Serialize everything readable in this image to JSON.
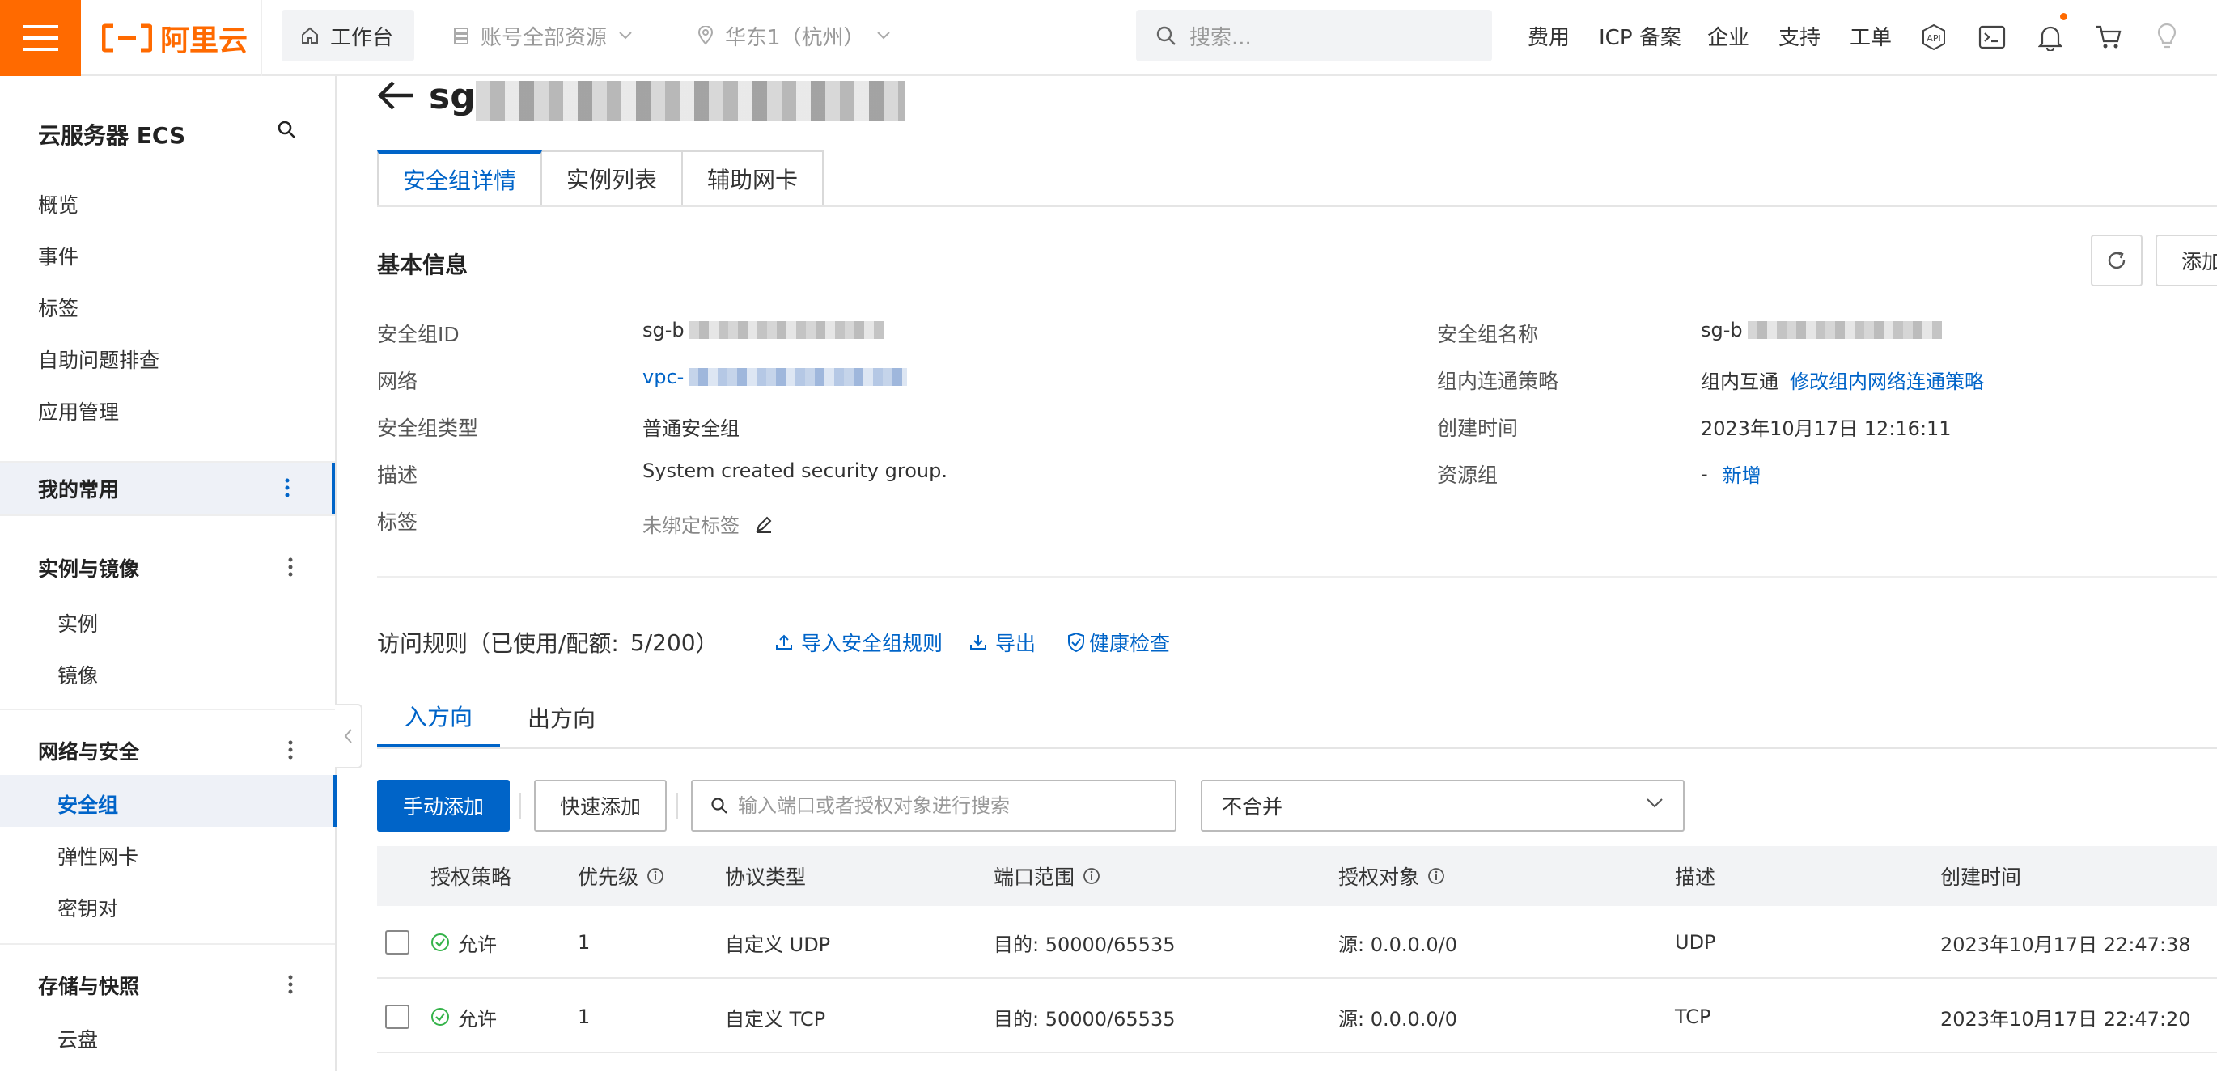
{
  "topbar": {
    "logo_text": "阿里云",
    "workbench": "工作台",
    "resource_scope": "账号全部资源",
    "region": "华东1（杭州）",
    "search_placeholder": "搜索...",
    "links": [
      "费用",
      "ICP 备案",
      "企业",
      "支持",
      "工单"
    ],
    "brand_color": "#ff6a00"
  },
  "sidebar": {
    "title": "云服务器 ECS",
    "top_items": [
      "概览",
      "事件",
      "标签",
      "自助问题排查",
      "应用管理"
    ],
    "groups": [
      {
        "label": "我的常用",
        "items": []
      },
      {
        "label": "实例与镜像",
        "items": [
          "实例",
          "镜像"
        ]
      },
      {
        "label": "网络与安全",
        "items": [
          "安全组",
          "弹性网卡",
          "密钥对"
        ]
      },
      {
        "label": "存储与快照",
        "items": [
          "云盘"
        ]
      }
    ],
    "active_item": "安全组",
    "accent_color": "#0064c8"
  },
  "page": {
    "title_prefix": "sg",
    "tabs": [
      "安全组详情",
      "实例列表",
      "辅助网卡"
    ],
    "active_tab": "安全组详情"
  },
  "basic_info": {
    "title": "基本信息",
    "add_button_label": "添加",
    "left": [
      {
        "label": "安全组ID",
        "value": "sg-b"
      },
      {
        "label": "网络",
        "value": "vpc-"
      },
      {
        "label": "安全组类型",
        "value": "普通安全组"
      },
      {
        "label": "描述",
        "value": "System created security group."
      },
      {
        "label": "标签",
        "value": "未绑定标签"
      }
    ],
    "right": [
      {
        "label": "安全组名称",
        "value": "sg-b"
      },
      {
        "label": "组内连通策略",
        "value": "组内互通",
        "link": "修改组内网络连通策略"
      },
      {
        "label": "创建时间",
        "value": "2023年10月17日 12:16:11"
      },
      {
        "label": "资源组",
        "value": "-",
        "link": "新增"
      }
    ]
  },
  "rules": {
    "heading": "访问规则（已使用/配额:",
    "quota": "5/200",
    "heading_suffix": "）",
    "actions": [
      "导入安全组规则",
      "导出",
      "健康检查"
    ],
    "direction_tabs": [
      "入方向",
      "出方向"
    ],
    "active_direction": "入方向",
    "manual_add": "手动添加",
    "quick_add": "快速添加",
    "search_placeholder": "输入端口或者授权对象进行搜索",
    "merge_option": "不合并",
    "columns": [
      "授权策略",
      "优先级",
      "协议类型",
      "端口范围",
      "授权对象",
      "描述",
      "创建时间"
    ],
    "rows": [
      {
        "policy": "允许",
        "priority": "1",
        "protocol": "自定义 UDP",
        "port": "目的: 50000/65535",
        "source": "源: 0.0.0.0/0",
        "desc": "UDP",
        "created": "2023年10月17日 22:47:38"
      },
      {
        "policy": "允许",
        "priority": "1",
        "protocol": "自定义 TCP",
        "port": "目的: 50000/65535",
        "source": "源: 0.0.0.0/0",
        "desc": "TCP",
        "created": "2023年10月17日 22:47:20"
      }
    ]
  }
}
